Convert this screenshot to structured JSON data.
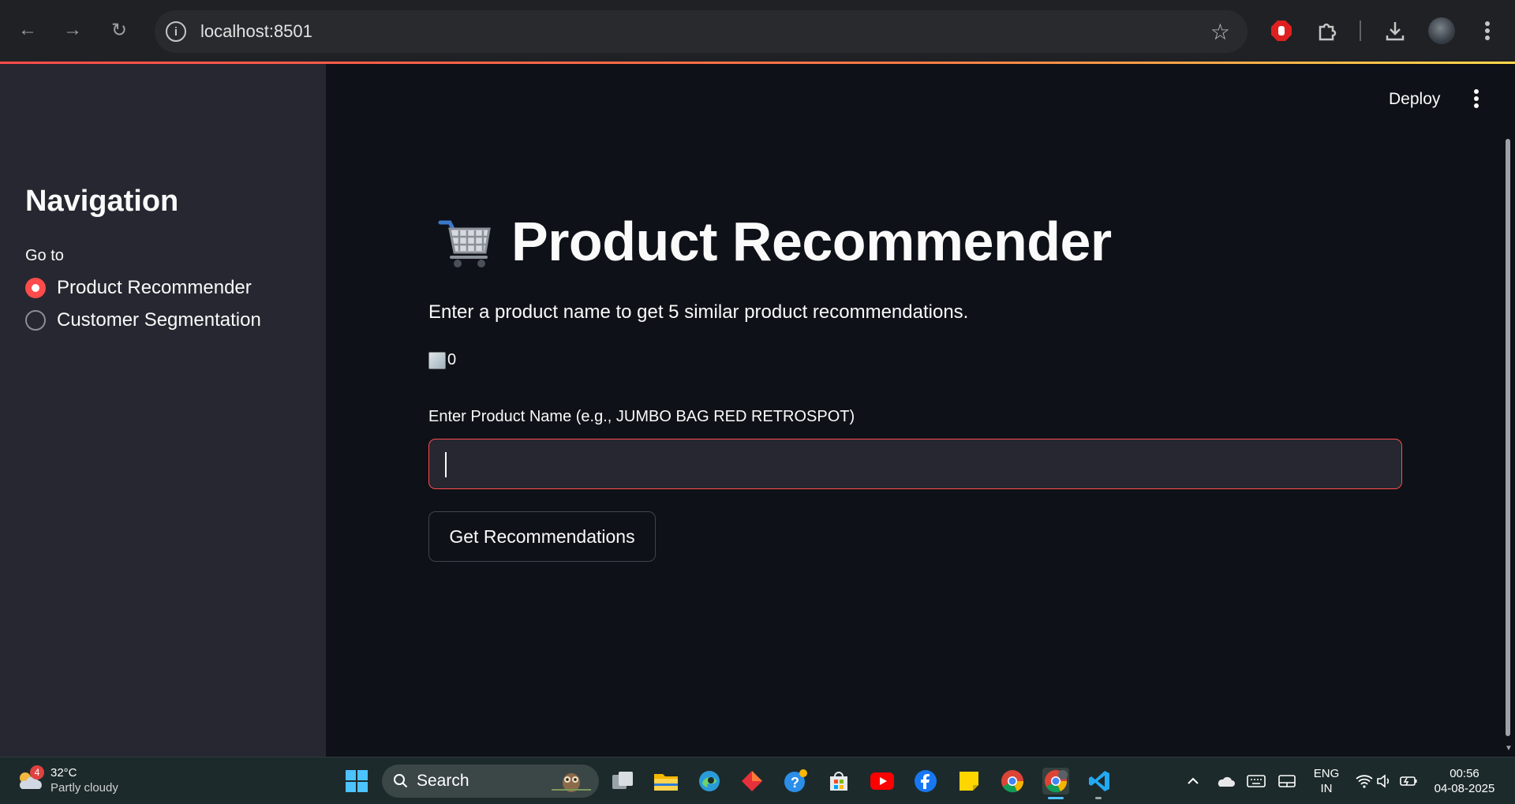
{
  "browser": {
    "url": "localhost:8501"
  },
  "sidebar": {
    "title": "Navigation",
    "radio_label": "Go to",
    "options": [
      {
        "label": "Product Recommender",
        "selected": true
      },
      {
        "label": "Customer Segmentation",
        "selected": false
      }
    ]
  },
  "header": {
    "deploy_label": "Deploy"
  },
  "main": {
    "title": "Product Recommender",
    "subtitle": "Enter a product name to get 5 similar product recommendations.",
    "image_alt": "0",
    "input_label": "Enter Product Name (e.g., JUMBO BAG RED RETROSPOT)",
    "input_value": "",
    "button_label": "Get Recommendations"
  },
  "taskbar": {
    "weather_badge": "4",
    "weather_temp": "32°C",
    "weather_condition": "Partly cloudy",
    "search_label": "Search",
    "language_top": "ENG",
    "language_bottom": "IN",
    "time": "00:56",
    "date": "04-08-2025"
  },
  "colors": {
    "accent": "#ff4b4b",
    "sidebar_bg": "#262730",
    "main_bg": "#0e1117"
  }
}
